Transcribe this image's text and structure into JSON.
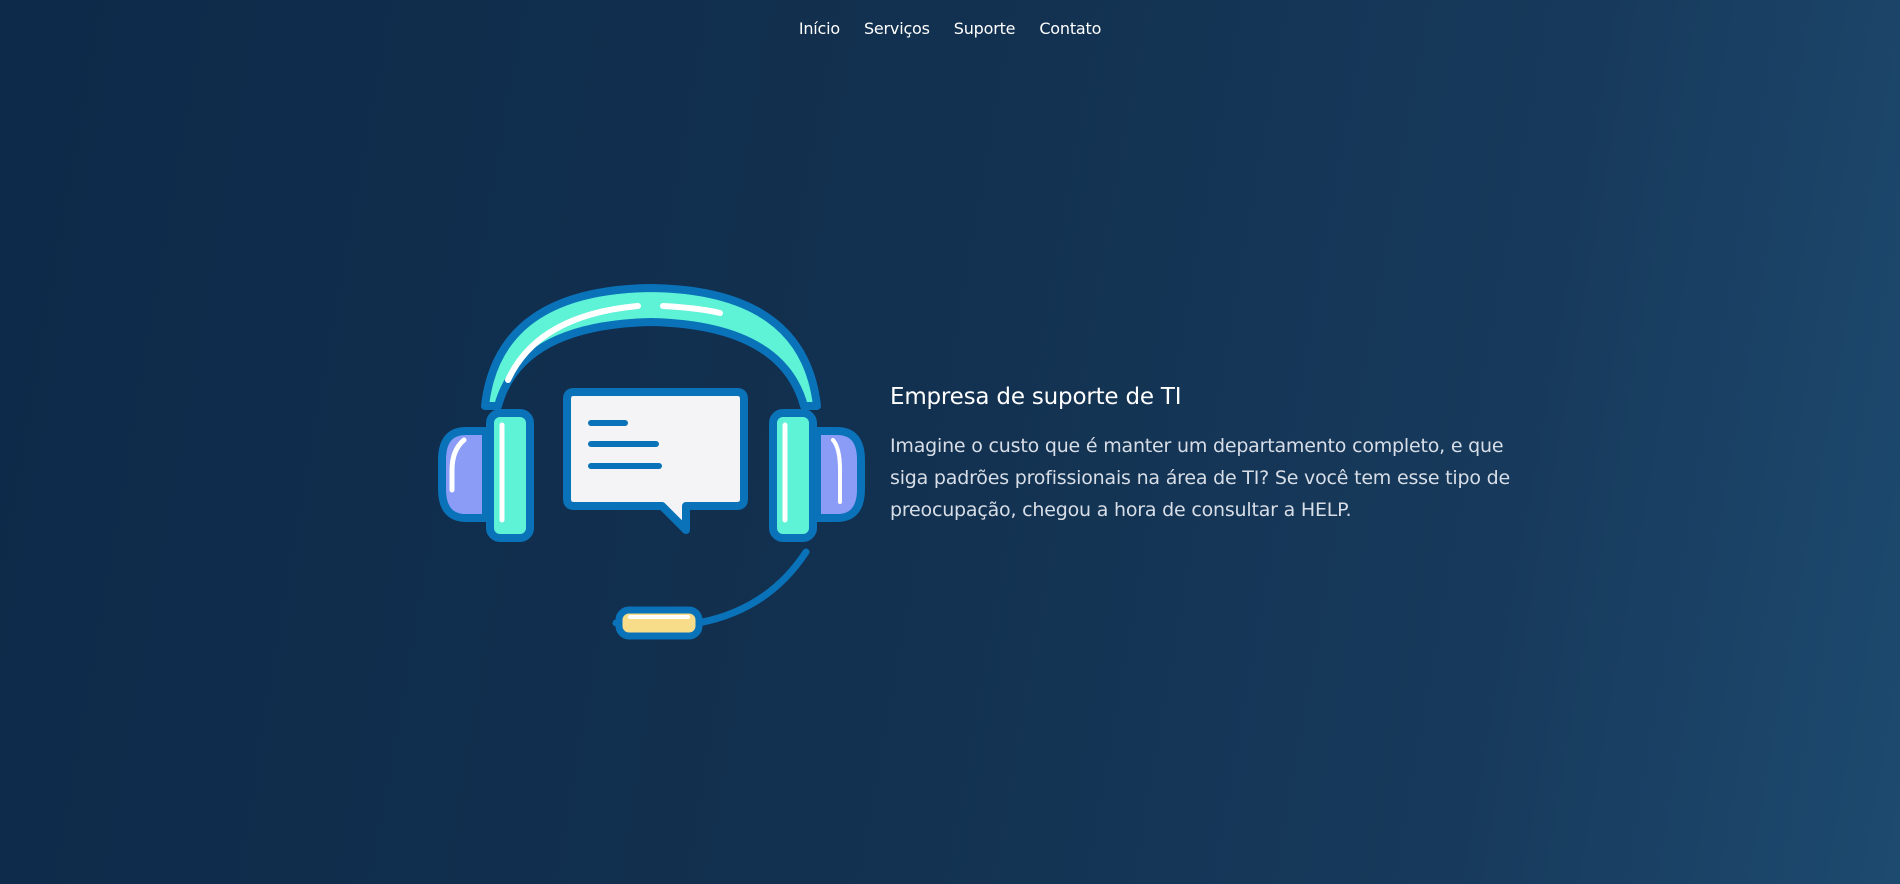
{
  "nav": {
    "items": [
      {
        "label": "Início"
      },
      {
        "label": "Serviços"
      },
      {
        "label": "Suporte"
      },
      {
        "label": "Contato"
      }
    ]
  },
  "hero": {
    "illustration_icon": "headset-chat-icon",
    "title": "Empresa de suporte de TI",
    "description": "Imagine o custo que é manter um departamento completo, e que siga padrões profissionais na área de TI? Se você tem esse tipo de preocupação, chegou a hora de consultar a HELP."
  },
  "colors": {
    "background_start": "#0e2a4a",
    "background_end": "#1d4a6f",
    "illustration_outline": "#0a72b8",
    "illustration_aqua": "#5ef2d6",
    "illustration_lavender": "#8b9cf7",
    "illustration_paper": "#f4f4f6",
    "illustration_mic": "#f7dc8a"
  }
}
